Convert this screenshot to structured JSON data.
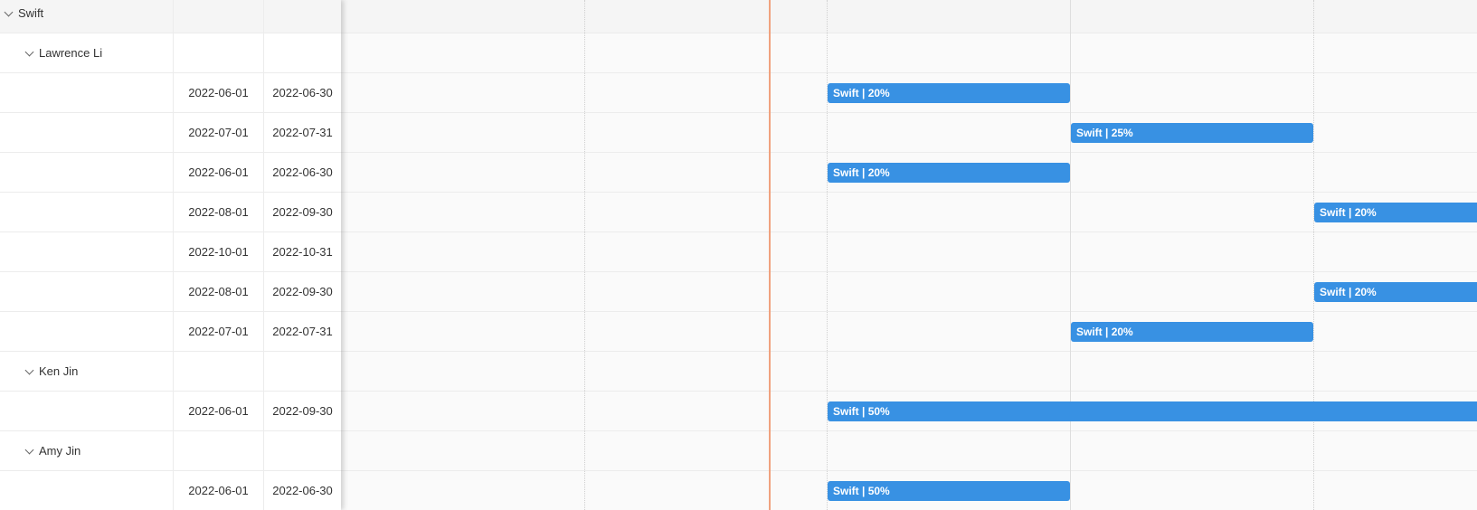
{
  "grid": {
    "rows": [
      {
        "type": "group",
        "level": 0,
        "name": "Swift"
      },
      {
        "type": "group",
        "level": 1,
        "name": "Lawrence Li"
      },
      {
        "type": "task",
        "start": "2022-06-01",
        "end": "2022-06-30"
      },
      {
        "type": "task",
        "start": "2022-07-01",
        "end": "2022-07-31"
      },
      {
        "type": "task",
        "start": "2022-06-01",
        "end": "2022-06-30"
      },
      {
        "type": "task",
        "start": "2022-08-01",
        "end": "2022-09-30"
      },
      {
        "type": "task",
        "start": "2022-10-01",
        "end": "2022-10-31"
      },
      {
        "type": "task",
        "start": "2022-08-01",
        "end": "2022-09-30"
      },
      {
        "type": "task",
        "start": "2022-07-01",
        "end": "2022-07-31"
      },
      {
        "type": "group",
        "level": 1,
        "name": "Ken Jin"
      },
      {
        "type": "task",
        "start": "2022-06-01",
        "end": "2022-09-30"
      },
      {
        "type": "group",
        "level": 1,
        "name": "Amy Jin"
      },
      {
        "type": "task",
        "start": "2022-06-01",
        "end": "2022-06-30"
      }
    ]
  },
  "timeline": {
    "bars": [
      {
        "row": 2,
        "label": "Swift | 20%",
        "start": "2022-06-01",
        "end": "2022-06-30"
      },
      {
        "row": 3,
        "label": "Swift | 25%",
        "start": "2022-07-01",
        "end": "2022-07-31"
      },
      {
        "row": 4,
        "label": "Swift | 20%",
        "start": "2022-06-01",
        "end": "2022-06-30"
      },
      {
        "row": 5,
        "label": "Swift | 20%",
        "start": "2022-08-01",
        "end": "2022-09-30"
      },
      {
        "row": 7,
        "label": "Swift | 20%",
        "start": "2022-08-01",
        "end": "2022-09-30"
      },
      {
        "row": 8,
        "label": "Swift | 20%",
        "start": "2022-07-01",
        "end": "2022-07-31"
      },
      {
        "row": 10,
        "label": "Swift | 50%",
        "start": "2022-06-01",
        "end": "2022-09-30"
      },
      {
        "row": 12,
        "label": "Swift | 50%",
        "start": "2022-06-01",
        "end": "2022-06-30"
      }
    ]
  },
  "colors": {
    "bar": "#3891e3",
    "today_line": "#f0a27e",
    "group_row_bg": "#f5f5f5"
  }
}
